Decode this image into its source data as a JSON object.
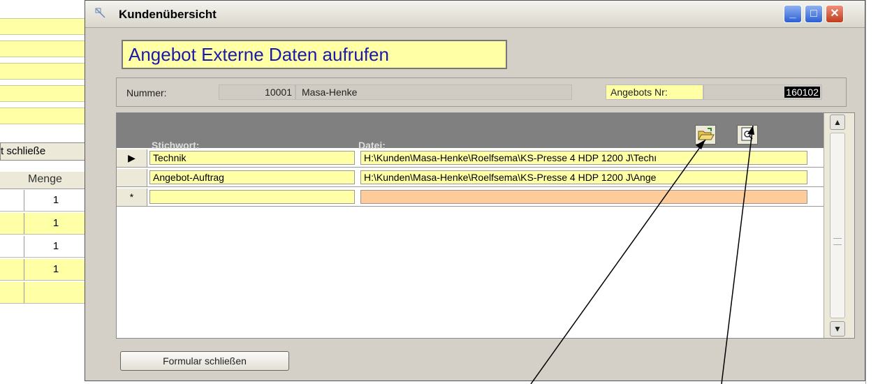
{
  "background_form": {
    "button_text": "t schließe",
    "column_header": "Menge",
    "rows": [
      "1",
      "1",
      "1",
      "1",
      ""
    ]
  },
  "window": {
    "title": "Kundenübersicht",
    "minimize_label": "_",
    "maximize_label": "□",
    "close_label": "✕",
    "heading": "Angebot Externe Daten aufrufen",
    "nummer_label": "Nummer:",
    "nummer_value": "10001",
    "customer_name": "Masa-Henke",
    "angebots_label": "Angebots Nr:",
    "angebots_value": "160102",
    "subform": {
      "col_stichwort": "Stichwort:",
      "col_datei": "Datei:",
      "rows": [
        {
          "marker": "▶",
          "stichwort": "Technik",
          "datei": "H:\\Kunden\\Masa-Henke\\Roelfsema\\KS-Presse 4 HDP 1200 J\\Techı"
        },
        {
          "marker": "",
          "stichwort": "Angebot-Auftrag",
          "datei": "H:\\Kunden\\Masa-Henke\\Roelfsema\\KS-Presse 4 HDP 1200 J\\Ange"
        },
        {
          "marker": "*",
          "stichwort": "",
          "datei": ""
        }
      ]
    },
    "close_button": "Formular schließen"
  },
  "icons": {
    "open_folder": "open-folder-icon",
    "view_file": "view-file-icon"
  }
}
